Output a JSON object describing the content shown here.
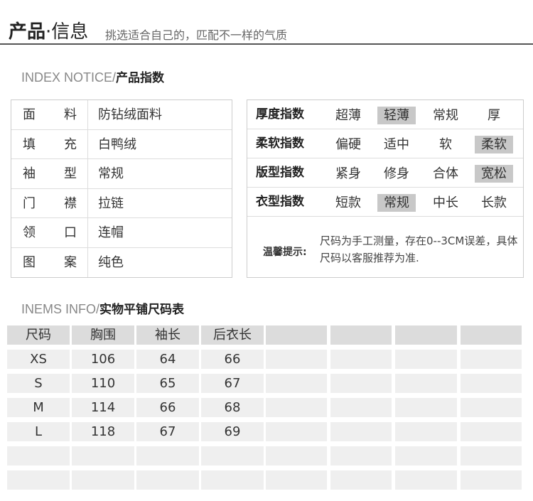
{
  "header": {
    "title_bold": "产品",
    "title_dot": "·",
    "title_light": "信息",
    "subtitle": "挑选适合自己的，匹配不一样的气质"
  },
  "index_section": {
    "title_en": "INDEX NOTICE/",
    "title_cn": "产品指数"
  },
  "product_table": [
    {
      "label": "面料",
      "value": "防钻绒面料"
    },
    {
      "label": "填充",
      "value": "白鸭绒"
    },
    {
      "label": "袖型",
      "value": "常规"
    },
    {
      "label": "门襟",
      "value": "拉链"
    },
    {
      "label": "领口",
      "value": "连帽"
    },
    {
      "label": "图案",
      "value": "纯色"
    }
  ],
  "index_table": [
    {
      "label": "厚度指数",
      "options": [
        "超薄",
        "轻薄",
        "常规",
        "厚"
      ],
      "selected": 1
    },
    {
      "label": "柔软指数",
      "options": [
        "偏硬",
        "适中",
        "软",
        "柔软"
      ],
      "selected": 3
    },
    {
      "label": "版型指数",
      "options": [
        "紧身",
        "修身",
        "合体",
        "宽松"
      ],
      "selected": 3
    },
    {
      "label": "衣型指数",
      "options": [
        "短款",
        "常规",
        "中长",
        "长款"
      ],
      "selected": 1
    }
  ],
  "tip": {
    "label": "温馨提示:",
    "text": "尺码为手工测量，存在0--3CM误差，具体尺码以客服推荐为准."
  },
  "size_section": {
    "title_en": "INEMS INFO/",
    "title_cn": "实物平铺尺码表"
  },
  "size_table": {
    "headers": [
      "尺码",
      "胸围",
      "袖长",
      "后衣长",
      "",
      "",
      "",
      ""
    ],
    "rows": [
      [
        "XS",
        "106",
        "64",
        "66",
        "",
        "",
        "",
        ""
      ],
      [
        "S",
        "110",
        "65",
        "67",
        "",
        "",
        "",
        ""
      ],
      [
        "M",
        "114",
        "66",
        "68",
        "",
        "",
        "",
        ""
      ],
      [
        "L",
        "118",
        "67",
        "69",
        "",
        "",
        "",
        ""
      ],
      [
        "",
        "",
        "",
        "",
        "",
        "",
        "",
        ""
      ],
      [
        "",
        "",
        "",
        "",
        "",
        "",
        "",
        ""
      ]
    ]
  }
}
